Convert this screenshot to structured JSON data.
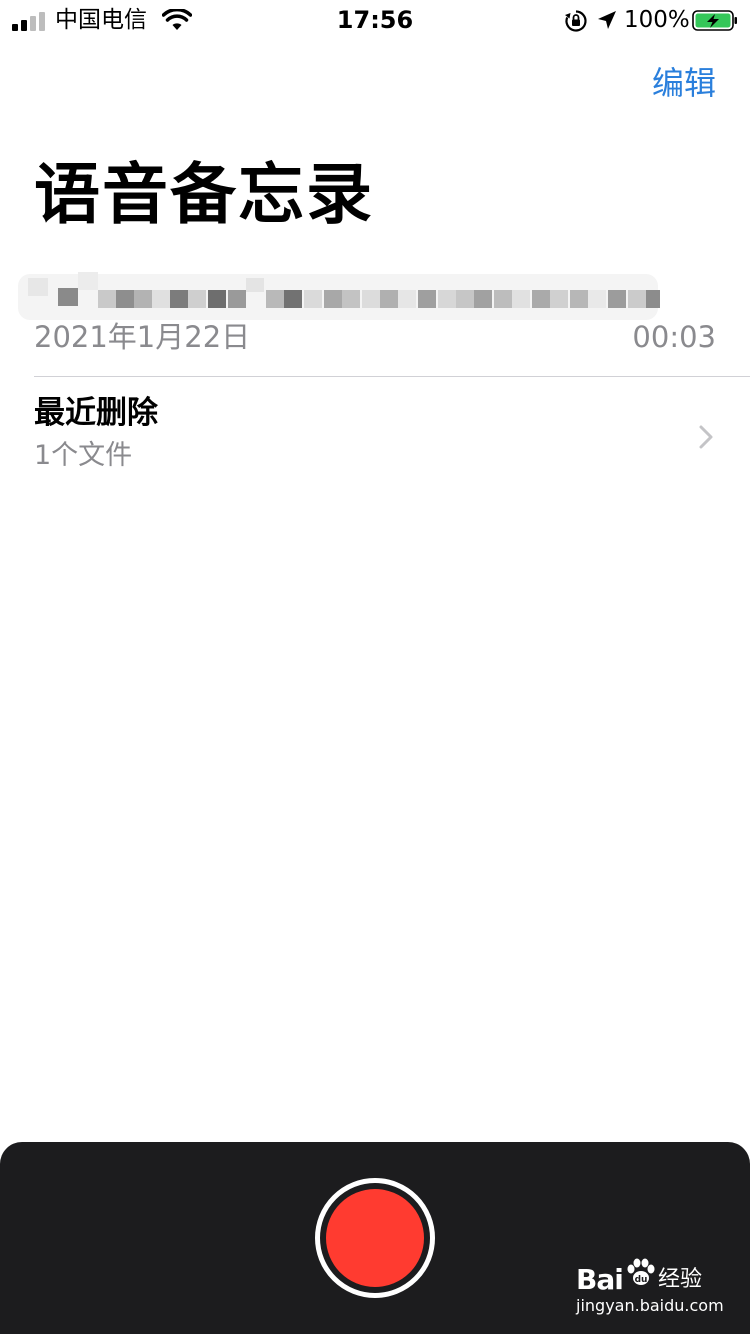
{
  "status_bar": {
    "carrier": "中国电信",
    "time": "17:56",
    "battery_percent": "100%",
    "icons": [
      "signal-icon",
      "wifi-icon",
      "orientation-lock-icon",
      "location-icon",
      "battery-charging-icon"
    ]
  },
  "nav": {
    "edit_label": "编辑"
  },
  "page_title": "语音备忘录",
  "recordings": [
    {
      "title": "",
      "title_obscured": true,
      "date": "2021年1月22日",
      "duration": "00:03"
    }
  ],
  "recently_deleted": {
    "label": "最近删除",
    "count": "1个文件",
    "icon": "chevron-right-icon"
  },
  "record_button": {
    "icon": "record-icon",
    "color": "#ff3b30"
  },
  "watermark": {
    "brand": "Bai",
    "product": "经验",
    "url": "jingyan.baidu.com"
  },
  "colors": {
    "accent": "#2a7fdc",
    "secondary_text": "#8a8a8e",
    "panel": "#1c1c1e",
    "record": "#ff3b30",
    "battery": "#34c759"
  }
}
